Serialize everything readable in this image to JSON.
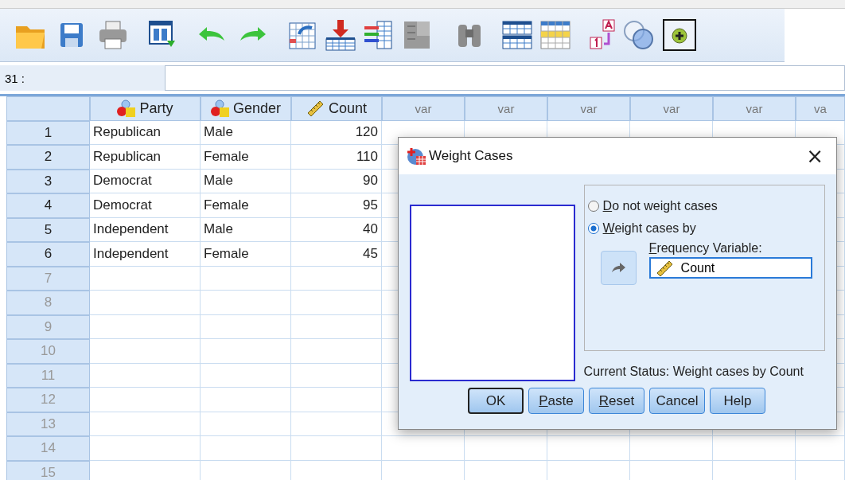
{
  "cell_reference": {
    "label": "31 :"
  },
  "grid": {
    "columns": [
      {
        "name": "Party",
        "kind": "nominal"
      },
      {
        "name": "Gender",
        "kind": "nominal"
      },
      {
        "name": "Count",
        "kind": "scale"
      },
      {
        "name": "var",
        "kind": "empty"
      },
      {
        "name": "var",
        "kind": "empty"
      },
      {
        "name": "var",
        "kind": "empty"
      },
      {
        "name": "var",
        "kind": "empty"
      },
      {
        "name": "var",
        "kind": "empty"
      },
      {
        "name": "va",
        "kind": "empty"
      }
    ],
    "rows": [
      {
        "number": "1",
        "cells": [
          "Republican",
          "Male",
          "120"
        ]
      },
      {
        "number": "2",
        "cells": [
          "Republican",
          "Female",
          "110"
        ]
      },
      {
        "number": "3",
        "cells": [
          "Democrat",
          "Male",
          "90"
        ]
      },
      {
        "number": "4",
        "cells": [
          "Democrat",
          "Female",
          "95"
        ]
      },
      {
        "number": "5",
        "cells": [
          "Independent",
          "Male",
          "40"
        ]
      },
      {
        "number": "6",
        "cells": [
          "Independent",
          "Female",
          "45"
        ]
      },
      {
        "number": "7"
      },
      {
        "number": "8"
      },
      {
        "number": "9"
      },
      {
        "number": "10"
      },
      {
        "number": "11"
      },
      {
        "number": "12"
      },
      {
        "number": "13"
      },
      {
        "number": "14"
      },
      {
        "number": "15"
      }
    ]
  },
  "dialog": {
    "title": "Weight Cases",
    "close": "×",
    "options": [
      {
        "key": "D",
        "rest": "o not weight cases",
        "selected": false
      },
      {
        "key": "W",
        "rest": "eight cases by",
        "selected": true
      }
    ],
    "frequency_label": {
      "key": "F",
      "rest": "requency Variable:"
    },
    "frequency_value": {
      "name": "Count",
      "kind": "scale"
    },
    "status": "Current Status: Weight cases by Count",
    "buttons": [
      {
        "rest": "OK",
        "default": true
      },
      {
        "key": "P",
        "rest": "aste",
        "default": false
      },
      {
        "key": "R",
        "rest": "eset",
        "default": false
      },
      {
        "rest": "Cancel",
        "default": false
      },
      {
        "rest": "Help",
        "default": false
      }
    ]
  }
}
